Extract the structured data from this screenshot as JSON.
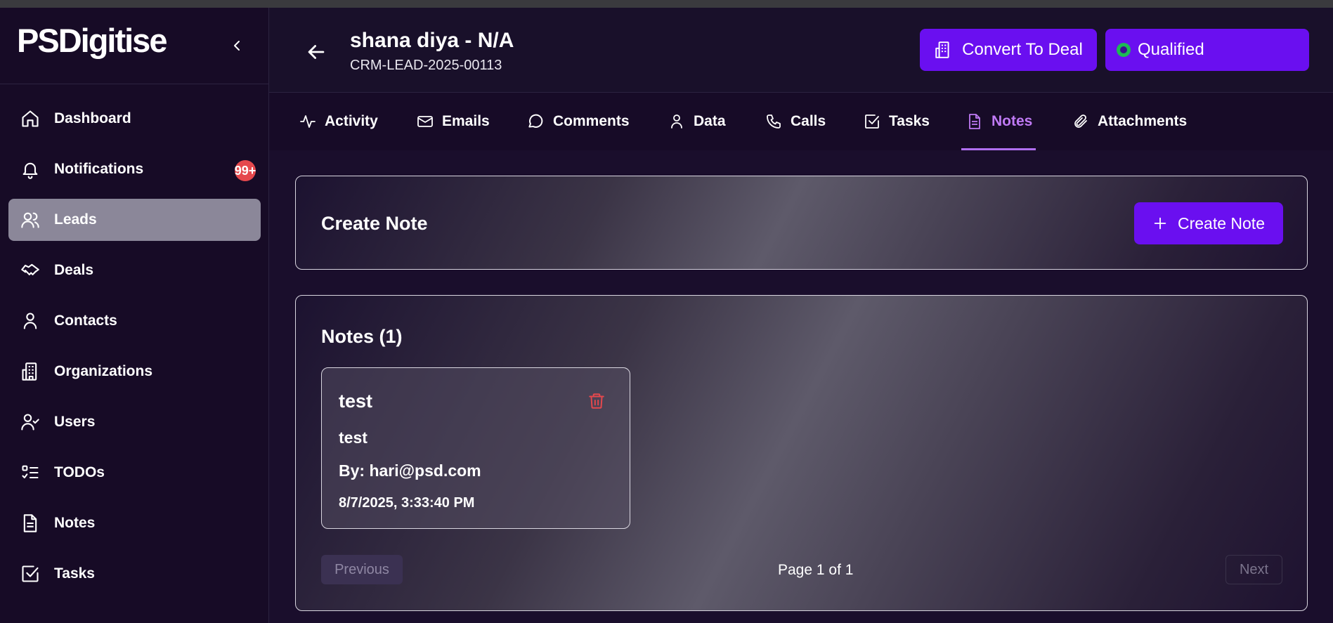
{
  "brand": {
    "logo_text": "PSDigitise"
  },
  "sidebar": {
    "items": [
      {
        "label": "Dashboard",
        "icon": "home-icon"
      },
      {
        "label": "Notifications",
        "icon": "bell-icon",
        "badge": "99+"
      },
      {
        "label": "Leads",
        "icon": "users-icon",
        "active": true
      },
      {
        "label": "Deals",
        "icon": "handshake-icon"
      },
      {
        "label": "Contacts",
        "icon": "user-icon"
      },
      {
        "label": "Organizations",
        "icon": "building-icon"
      },
      {
        "label": "Users",
        "icon": "user-check-icon"
      },
      {
        "label": "TODOs",
        "icon": "list-checks-icon"
      },
      {
        "label": "Notes",
        "icon": "file-text-icon"
      },
      {
        "label": "Tasks",
        "icon": "square-check-icon"
      }
    ]
  },
  "header": {
    "title": "shana diya - N/A",
    "lead_id": "CRM-LEAD-2025-00113",
    "convert_label": "Convert To Deal",
    "status_label": "Qualified"
  },
  "tabs": [
    {
      "label": "Activity",
      "icon": "activity-icon"
    },
    {
      "label": "Emails",
      "icon": "mail-icon"
    },
    {
      "label": "Comments",
      "icon": "message-circle-icon"
    },
    {
      "label": "Data",
      "icon": "user-icon"
    },
    {
      "label": "Calls",
      "icon": "phone-icon"
    },
    {
      "label": "Tasks",
      "icon": "square-check-icon"
    },
    {
      "label": "Notes",
      "icon": "file-text-icon",
      "active": true
    },
    {
      "label": "Attachments",
      "icon": "paperclip-icon"
    }
  ],
  "create_note": {
    "title": "Create Note",
    "button_label": "Create Note"
  },
  "notes": {
    "title": "Notes (1)",
    "items": [
      {
        "title": "test",
        "body": "test",
        "author": "By: hari@psd.com",
        "date": "8/7/2025, 3:33:40 PM"
      }
    ],
    "pagination": {
      "previous": "Previous",
      "page_text": "Page 1 of 1",
      "next": "Next"
    }
  },
  "colors": {
    "accent": "#6a0ff0",
    "active_tab": "#c07af5",
    "status_dot": "#1db954",
    "badge": "#e5484d",
    "delete": "#e5484d"
  }
}
